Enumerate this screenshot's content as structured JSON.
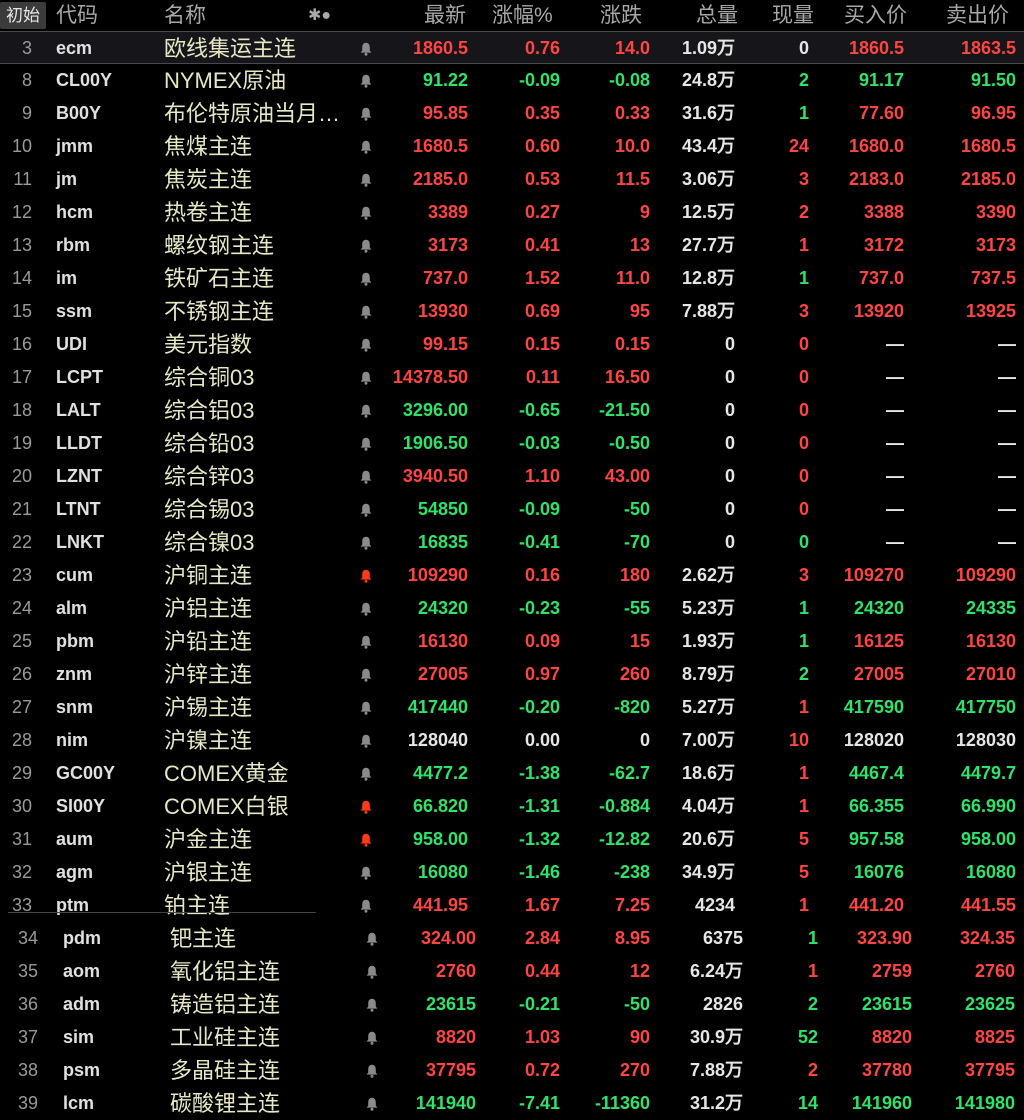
{
  "header": {
    "init_button": "初始",
    "col_code": "代码",
    "col_name": "名称",
    "col_icons": "✱●",
    "col_last": "最新",
    "col_pct": "涨幅%",
    "col_change": "涨跌",
    "col_volume": "总量",
    "col_curvol": "现量",
    "col_bid": "买入价",
    "col_ask": "卖出价"
  },
  "colors": {
    "up": "#ff4444",
    "down": "#2ee36a",
    "flat": "#e6e6e6",
    "bell_normal": "#8a8a8a",
    "bell_alert": "#ff3a1a"
  },
  "rows": [
    {
      "idx": "3",
      "code": "ecm",
      "name": "欧线集运主连",
      "bell": "normal",
      "last": "1860.5",
      "pct": "0.76",
      "chg": "14.0",
      "vol": "1.09万",
      "cur": "0",
      "bid": "1860.5",
      "ask": "1863.5",
      "dir": "up",
      "cur_dir": "flat"
    },
    {
      "idx": "8",
      "code": "CL00Y",
      "name": "NYMEX原油",
      "bell": "normal",
      "last": "91.22",
      "pct": "-0.09",
      "chg": "-0.08",
      "vol": "24.8万",
      "cur": "2",
      "bid": "91.17",
      "ask": "91.50",
      "dir": "down",
      "cur_dir": "down"
    },
    {
      "idx": "9",
      "code": "B00Y",
      "name": "布伦特原油当月…",
      "bell": "normal",
      "last": "95.85",
      "pct": "0.35",
      "chg": "0.33",
      "vol": "31.6万",
      "cur": "1",
      "bid": "77.60",
      "ask": "96.95",
      "dir": "up",
      "cur_dir": "down"
    },
    {
      "idx": "10",
      "code": "jmm",
      "name": "焦煤主连",
      "bell": "normal",
      "last": "1680.5",
      "pct": "0.60",
      "chg": "10.0",
      "vol": "43.4万",
      "cur": "24",
      "bid": "1680.0",
      "ask": "1680.5",
      "dir": "up",
      "cur_dir": "up"
    },
    {
      "idx": "11",
      "code": "jm",
      "name": "焦炭主连",
      "bell": "normal",
      "last": "2185.0",
      "pct": "0.53",
      "chg": "11.5",
      "vol": "3.06万",
      "cur": "3",
      "bid": "2183.0",
      "ask": "2185.0",
      "dir": "up",
      "cur_dir": "up"
    },
    {
      "idx": "12",
      "code": "hcm",
      "name": "热卷主连",
      "bell": "normal",
      "last": "3389",
      "pct": "0.27",
      "chg": "9",
      "vol": "12.5万",
      "cur": "2",
      "bid": "3388",
      "ask": "3390",
      "dir": "up",
      "cur_dir": "up"
    },
    {
      "idx": "13",
      "code": "rbm",
      "name": "螺纹钢主连",
      "bell": "normal",
      "last": "3173",
      "pct": "0.41",
      "chg": "13",
      "vol": "27.7万",
      "cur": "1",
      "bid": "3172",
      "ask": "3173",
      "dir": "up",
      "cur_dir": "up"
    },
    {
      "idx": "14",
      "code": "im",
      "name": "铁矿石主连",
      "bell": "normal",
      "last": "737.0",
      "pct": "1.52",
      "chg": "11.0",
      "vol": "12.8万",
      "cur": "1",
      "bid": "737.0",
      "ask": "737.5",
      "dir": "up",
      "cur_dir": "down"
    },
    {
      "idx": "15",
      "code": "ssm",
      "name": "不锈钢主连",
      "bell": "normal",
      "last": "13930",
      "pct": "0.69",
      "chg": "95",
      "vol": "7.88万",
      "cur": "3",
      "bid": "13920",
      "ask": "13925",
      "dir": "up",
      "cur_dir": "up"
    },
    {
      "idx": "16",
      "code": "UDI",
      "name": "美元指数",
      "bell": "normal",
      "last": "99.15",
      "pct": "0.15",
      "chg": "0.15",
      "vol": "0",
      "cur": "0",
      "bid": "—",
      "ask": "—",
      "dir": "up",
      "cur_dir": "up"
    },
    {
      "idx": "17",
      "code": "LCPT",
      "name": "综合铜03",
      "bell": "normal",
      "last": "14378.50",
      "pct": "0.11",
      "chg": "16.50",
      "vol": "0",
      "cur": "0",
      "bid": "—",
      "ask": "—",
      "dir": "up",
      "cur_dir": "up"
    },
    {
      "idx": "18",
      "code": "LALT",
      "name": "综合铝03",
      "bell": "normal",
      "last": "3296.00",
      "pct": "-0.65",
      "chg": "-21.50",
      "vol": "0",
      "cur": "0",
      "bid": "—",
      "ask": "—",
      "dir": "down",
      "cur_dir": "up"
    },
    {
      "idx": "19",
      "code": "LLDT",
      "name": "综合铅03",
      "bell": "normal",
      "last": "1906.50",
      "pct": "-0.03",
      "chg": "-0.50",
      "vol": "0",
      "cur": "0",
      "bid": "—",
      "ask": "—",
      "dir": "down",
      "cur_dir": "up"
    },
    {
      "idx": "20",
      "code": "LZNT",
      "name": "综合锌03",
      "bell": "normal",
      "last": "3940.50",
      "pct": "1.10",
      "chg": "43.00",
      "vol": "0",
      "cur": "0",
      "bid": "—",
      "ask": "—",
      "dir": "up",
      "cur_dir": "up"
    },
    {
      "idx": "21",
      "code": "LTNT",
      "name": "综合锡03",
      "bell": "normal",
      "last": "54850",
      "pct": "-0.09",
      "chg": "-50",
      "vol": "0",
      "cur": "0",
      "bid": "—",
      "ask": "—",
      "dir": "down",
      "cur_dir": "up"
    },
    {
      "idx": "22",
      "code": "LNKT",
      "name": "综合镍03",
      "bell": "normal",
      "last": "16835",
      "pct": "-0.41",
      "chg": "-70",
      "vol": "0",
      "cur": "0",
      "bid": "—",
      "ask": "—",
      "dir": "down",
      "cur_dir": "down"
    },
    {
      "idx": "23",
      "code": "cum",
      "name": "沪铜主连",
      "bell": "alert",
      "last": "109290",
      "pct": "0.16",
      "chg": "180",
      "vol": "2.62万",
      "cur": "3",
      "bid": "109270",
      "ask": "109290",
      "dir": "up",
      "cur_dir": "up"
    },
    {
      "idx": "24",
      "code": "alm",
      "name": "沪铝主连",
      "bell": "normal",
      "last": "24320",
      "pct": "-0.23",
      "chg": "-55",
      "vol": "5.23万",
      "cur": "1",
      "bid": "24320",
      "ask": "24335",
      "dir": "down",
      "cur_dir": "down"
    },
    {
      "idx": "25",
      "code": "pbm",
      "name": "沪铅主连",
      "bell": "normal",
      "last": "16130",
      "pct": "0.09",
      "chg": "15",
      "vol": "1.93万",
      "cur": "1",
      "bid": "16125",
      "ask": "16130",
      "dir": "up",
      "cur_dir": "down"
    },
    {
      "idx": "26",
      "code": "znm",
      "name": "沪锌主连",
      "bell": "normal",
      "last": "27005",
      "pct": "0.97",
      "chg": "260",
      "vol": "8.79万",
      "cur": "2",
      "bid": "27005",
      "ask": "27010",
      "dir": "up",
      "cur_dir": "down"
    },
    {
      "idx": "27",
      "code": "snm",
      "name": "沪锡主连",
      "bell": "normal",
      "last": "417440",
      "pct": "-0.20",
      "chg": "-820",
      "vol": "5.27万",
      "cur": "1",
      "bid": "417590",
      "ask": "417750",
      "dir": "down",
      "cur_dir": "up"
    },
    {
      "idx": "28",
      "code": "nim",
      "name": "沪镍主连",
      "bell": "normal",
      "last": "128040",
      "pct": "0.00",
      "chg": "0",
      "vol": "7.00万",
      "cur": "10",
      "bid": "128020",
      "ask": "128030",
      "dir": "flat",
      "cur_dir": "up"
    },
    {
      "idx": "29",
      "code": "GC00Y",
      "name": "COMEX黄金",
      "bell": "normal",
      "last": "4477.2",
      "pct": "-1.38",
      "chg": "-62.7",
      "vol": "18.6万",
      "cur": "1",
      "bid": "4467.4",
      "ask": "4479.7",
      "dir": "down",
      "cur_dir": "up"
    },
    {
      "idx": "30",
      "code": "SI00Y",
      "name": "COMEX白银",
      "bell": "alert",
      "last": "66.820",
      "pct": "-1.31",
      "chg": "-0.884",
      "vol": "4.04万",
      "cur": "1",
      "bid": "66.355",
      "ask": "66.990",
      "dir": "down",
      "cur_dir": "up"
    },
    {
      "idx": "31",
      "code": "aum",
      "name": "沪金主连",
      "bell": "alert",
      "last": "958.00",
      "pct": "-1.32",
      "chg": "-12.82",
      "vol": "20.6万",
      "cur": "5",
      "bid": "957.58",
      "ask": "958.00",
      "dir": "down",
      "cur_dir": "up"
    },
    {
      "idx": "32",
      "code": "agm",
      "name": "沪银主连",
      "bell": "normal",
      "last": "16080",
      "pct": "-1.46",
      "chg": "-238",
      "vol": "34.9万",
      "cur": "5",
      "bid": "16076",
      "ask": "16080",
      "dir": "down",
      "cur_dir": "up"
    },
    {
      "idx": "33",
      "code": "ptm",
      "name": "铂主连",
      "bell": "normal",
      "last": "441.95",
      "pct": "1.67",
      "chg": "7.25",
      "vol": "4234",
      "cur": "1",
      "bid": "441.20",
      "ask": "441.55",
      "dir": "up",
      "cur_dir": "up"
    },
    {
      "idx": "34",
      "code": "pdm",
      "name": "钯主连",
      "bell": "normal",
      "last": "324.00",
      "pct": "2.84",
      "chg": "8.95",
      "vol": "6375",
      "cur": "1",
      "bid": "323.90",
      "ask": "324.35",
      "dir": "up",
      "cur_dir": "down"
    },
    {
      "idx": "35",
      "code": "aom",
      "name": "氧化铝主连",
      "bell": "normal",
      "last": "2760",
      "pct": "0.44",
      "chg": "12",
      "vol": "6.24万",
      "cur": "1",
      "bid": "2759",
      "ask": "2760",
      "dir": "up",
      "cur_dir": "up"
    },
    {
      "idx": "36",
      "code": "adm",
      "name": "铸造铝主连",
      "bell": "normal",
      "last": "23615",
      "pct": "-0.21",
      "chg": "-50",
      "vol": "2826",
      "cur": "2",
      "bid": "23615",
      "ask": "23625",
      "dir": "down",
      "cur_dir": "down"
    },
    {
      "idx": "37",
      "code": "sim",
      "name": "工业硅主连",
      "bell": "normal",
      "last": "8820",
      "pct": "1.03",
      "chg": "90",
      "vol": "30.9万",
      "cur": "52",
      "bid": "8820",
      "ask": "8825",
      "dir": "up",
      "cur_dir": "down"
    },
    {
      "idx": "38",
      "code": "psm",
      "name": "多晶硅主连",
      "bell": "normal",
      "last": "37795",
      "pct": "0.72",
      "chg": "270",
      "vol": "7.88万",
      "cur": "2",
      "bid": "37780",
      "ask": "37795",
      "dir": "up",
      "cur_dir": "up"
    },
    {
      "idx": "39",
      "code": "lcm",
      "name": "碳酸锂主连",
      "bell": "normal",
      "last": "141940",
      "pct": "-7.41",
      "chg": "-11360",
      "vol": "31.2万",
      "cur": "14",
      "bid": "141960",
      "ask": "141980",
      "dir": "down",
      "cur_dir": "down"
    }
  ]
}
